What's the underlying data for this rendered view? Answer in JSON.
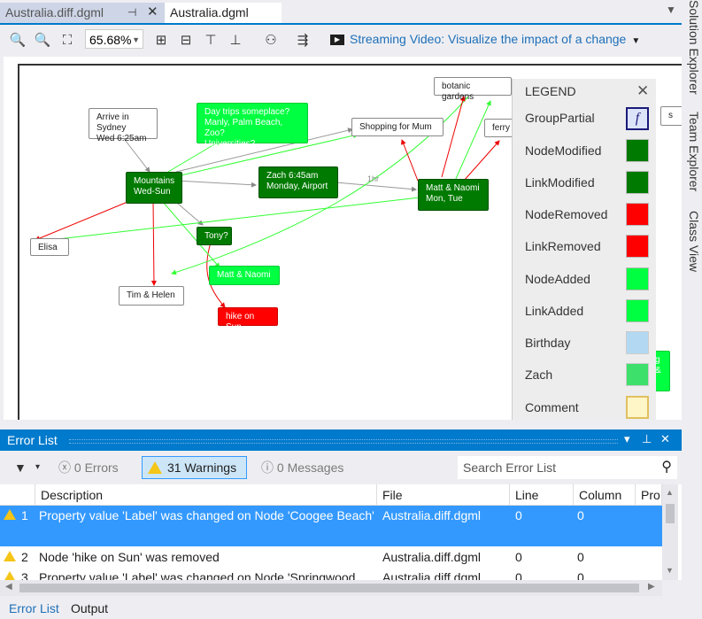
{
  "tabs": [
    {
      "label": "Australia.diff.dgml",
      "active": false,
      "pin": "⊣",
      "close": "✕"
    },
    {
      "label": "Australia.dgml",
      "active": true
    }
  ],
  "toolbar": {
    "zoom": "65.68%",
    "streaming_label": "Streaming Video: Visualize the impact of a change"
  },
  "graph": {
    "nodes": {
      "arrive": "Arrive in Sydney\nWed 6:25am",
      "daytrips": "Day trips someplace?\nManly, Palm Beach, Zoo?\nUniversities?",
      "shopping": "Shopping for Mum",
      "botanic": "botanic gardens",
      "ferry": "ferry",
      "mountains": "Mountains\nWed-Sun",
      "zach": "Zach 6:45am\nMonday, Airport",
      "mattnaomi_tue": "Matt & Naomi\nMon, Tue",
      "elisa": "Elisa",
      "tony": "Tony?",
      "mattnaomi": "Matt & Naomi",
      "timhelen": "Tim & Helen",
      "hike": "hike on Sun",
      "partial1": "s",
      "partial2": "g\n&"
    },
    "edge_label_1hr": "1hr"
  },
  "legend": {
    "title": "LEGEND",
    "close": "✕",
    "items": [
      {
        "label": "GroupPartial",
        "color": "#dbe4f9",
        "border": "#1a1a7a",
        "glyph": "f"
      },
      {
        "label": "NodeModified",
        "color": "#007a00"
      },
      {
        "label": "LinkModified",
        "color": "#007a00"
      },
      {
        "label": "NodeRemoved",
        "color": "#ff0000"
      },
      {
        "label": "LinkRemoved",
        "color": "#ff0000"
      },
      {
        "label": "NodeAdded",
        "color": "#00ff40"
      },
      {
        "label": "LinkAdded",
        "color": "#00ff40"
      },
      {
        "label": "Birthday",
        "color": "#b3d9f2"
      },
      {
        "label": "Zach",
        "color": "#3de06a"
      },
      {
        "label": "Comment",
        "color": "#fff6c8",
        "border": "#e0c060"
      }
    ]
  },
  "side_tabs": [
    "Solution Explorer",
    "Team Explorer",
    "Class View"
  ],
  "error_list": {
    "title": "Error List",
    "controls": {
      "dropdown": "▾",
      "pin": "⊥",
      "close": "✕"
    },
    "filters": {
      "errors": "0 Errors",
      "warnings": "31 Warnings",
      "messages": "0 Messages"
    },
    "search_placeholder": "Search Error List",
    "columns": [
      "",
      "Description",
      "File",
      "Line",
      "Column",
      "Pro"
    ],
    "rows": [
      {
        "num": "1",
        "description": "Property value 'Label' was changed on Node 'Coogee Beach'",
        "file": "Australia.diff.dgml",
        "line": "0",
        "column": "0",
        "selected": true
      },
      {
        "num": "2",
        "description": "Node 'hike on Sun' was removed",
        "file": "Australia.diff.dgml",
        "line": "0",
        "column": "0",
        "selected": false
      },
      {
        "num": "3",
        "description": "Property value 'Label' was changed on Node 'Springwood",
        "file": "Australia.diff.dgml",
        "line": "0",
        "column": "0",
        "selected": false
      }
    ]
  },
  "bottom_tabs": [
    "Error List",
    "Output"
  ]
}
